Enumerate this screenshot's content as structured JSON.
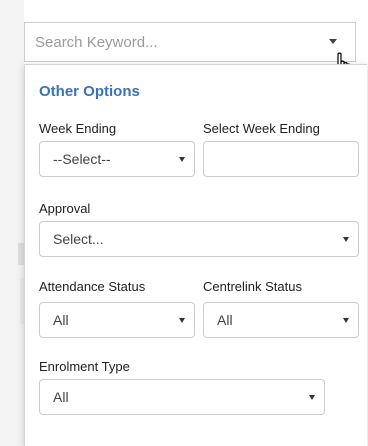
{
  "search": {
    "placeholder": "Search Keyword..."
  },
  "panel": {
    "title": "Other Options",
    "week_ending": {
      "label": "Week Ending",
      "selected": "--Select--"
    },
    "select_week_ending": {
      "label": "Select Week Ending",
      "value": ""
    },
    "approval": {
      "label": "Approval",
      "selected": "Select..."
    },
    "attendance_status": {
      "label": "Attendance Status",
      "selected": "All"
    },
    "centrelink_status": {
      "label": "Centrelink Status",
      "selected": "All"
    },
    "enrolment_type": {
      "label": "Enrolment Type",
      "selected": "All"
    }
  },
  "icons": {
    "dropdown": "chevron-down-icon",
    "cursor": "hand-pointer-icon"
  },
  "colors": {
    "accent": "#3b73b9",
    "border": "#cccccc",
    "text": "#333333",
    "placeholder": "#9a9a9a"
  }
}
